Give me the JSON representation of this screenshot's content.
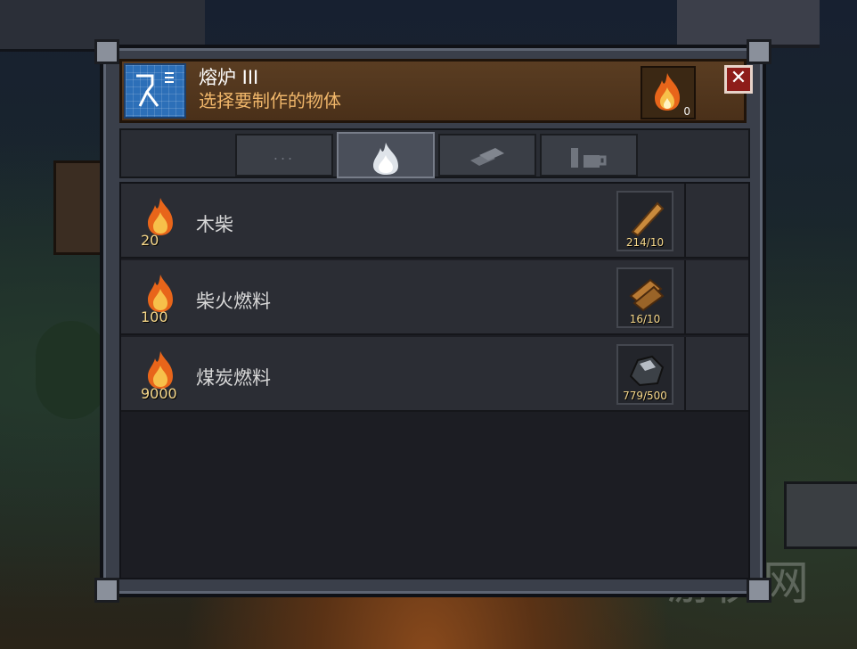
{
  "window": {
    "title": "熔炉 III",
    "subtitle": "选择要制作的物体",
    "fuel_count": "0",
    "close_label": "✕"
  },
  "tabs": [
    {
      "label": "...",
      "icon": "dots-icon",
      "active": false
    },
    {
      "label": "",
      "icon": "white-flame-icon",
      "active": true
    },
    {
      "label": "",
      "icon": "metal-bars-icon",
      "active": false
    },
    {
      "label": "",
      "icon": "cup-icon",
      "active": false
    }
  ],
  "recipes": [
    {
      "name": "木柴",
      "fuel_value": "20",
      "ingredient_icon": "wood-log-icon",
      "ingredient_stock": "214/10"
    },
    {
      "name": "柴火燃料",
      "fuel_value": "100",
      "ingredient_icon": "firewood-bundle-icon",
      "ingredient_stock": "16/10"
    },
    {
      "name": "煤炭燃料",
      "fuel_value": "9000",
      "ingredient_icon": "coal-icon",
      "ingredient_stock": "779/500"
    }
  ],
  "colors": {
    "header_bg": "#5a3d22",
    "subtitle": "#f0b66a",
    "amount": "#f7d88a",
    "close_bg": "#8e1d1a"
  },
  "watermark": "游侠网"
}
